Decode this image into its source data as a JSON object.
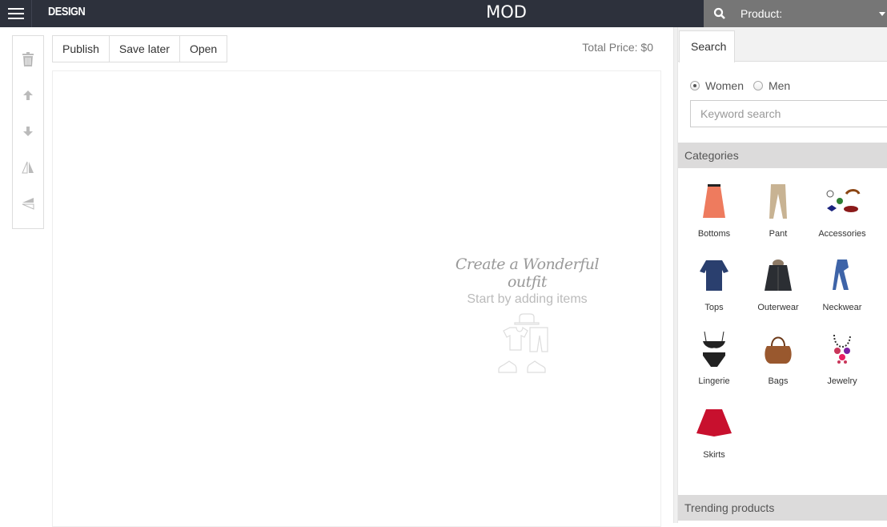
{
  "header": {
    "logo": "DESIGN",
    "title": "MOD",
    "product_search_label": "Product:"
  },
  "side_tools": [
    {
      "name": "delete",
      "icon": "trash-icon"
    },
    {
      "name": "move-up",
      "icon": "arrow-up-icon"
    },
    {
      "name": "move-down",
      "icon": "arrow-down-icon"
    },
    {
      "name": "flip-horizontal",
      "icon": "flip-horizontal-icon"
    },
    {
      "name": "flip-vertical",
      "icon": "flip-vertical-icon"
    }
  ],
  "actions": {
    "publish": "Publish",
    "save_later": "Save later",
    "open": "Open"
  },
  "total_price": "Total Price: $0",
  "canvas": {
    "headline": "Create a Wonderful outfit",
    "subline": "Start by adding items"
  },
  "panel": {
    "tab": "Search",
    "gender": {
      "options": [
        "Women",
        "Men"
      ],
      "selected": "Women"
    },
    "keyword_placeholder": "Keyword search",
    "keyword_value": "",
    "categories_title": "Categories",
    "categories": [
      {
        "label": "Bottoms",
        "color": "#ee7b5e"
      },
      {
        "label": "Pant",
        "color": "#c8b393"
      },
      {
        "label": "Accessories",
        "color": "#8b1a1a"
      },
      {
        "label": "Tops",
        "color": "#2a3f6e"
      },
      {
        "label": "Outerwear",
        "color": "#2b2e33"
      },
      {
        "label": "Neckwear",
        "color": "#3e64a8"
      },
      {
        "label": "Lingerie",
        "color": "#222222"
      },
      {
        "label": "Bags",
        "color": "#99582e"
      },
      {
        "label": "Jewelry",
        "color": "#c9365a"
      },
      {
        "label": "Skirts",
        "color": "#c8102e"
      }
    ],
    "trending_title": "Trending products"
  }
}
